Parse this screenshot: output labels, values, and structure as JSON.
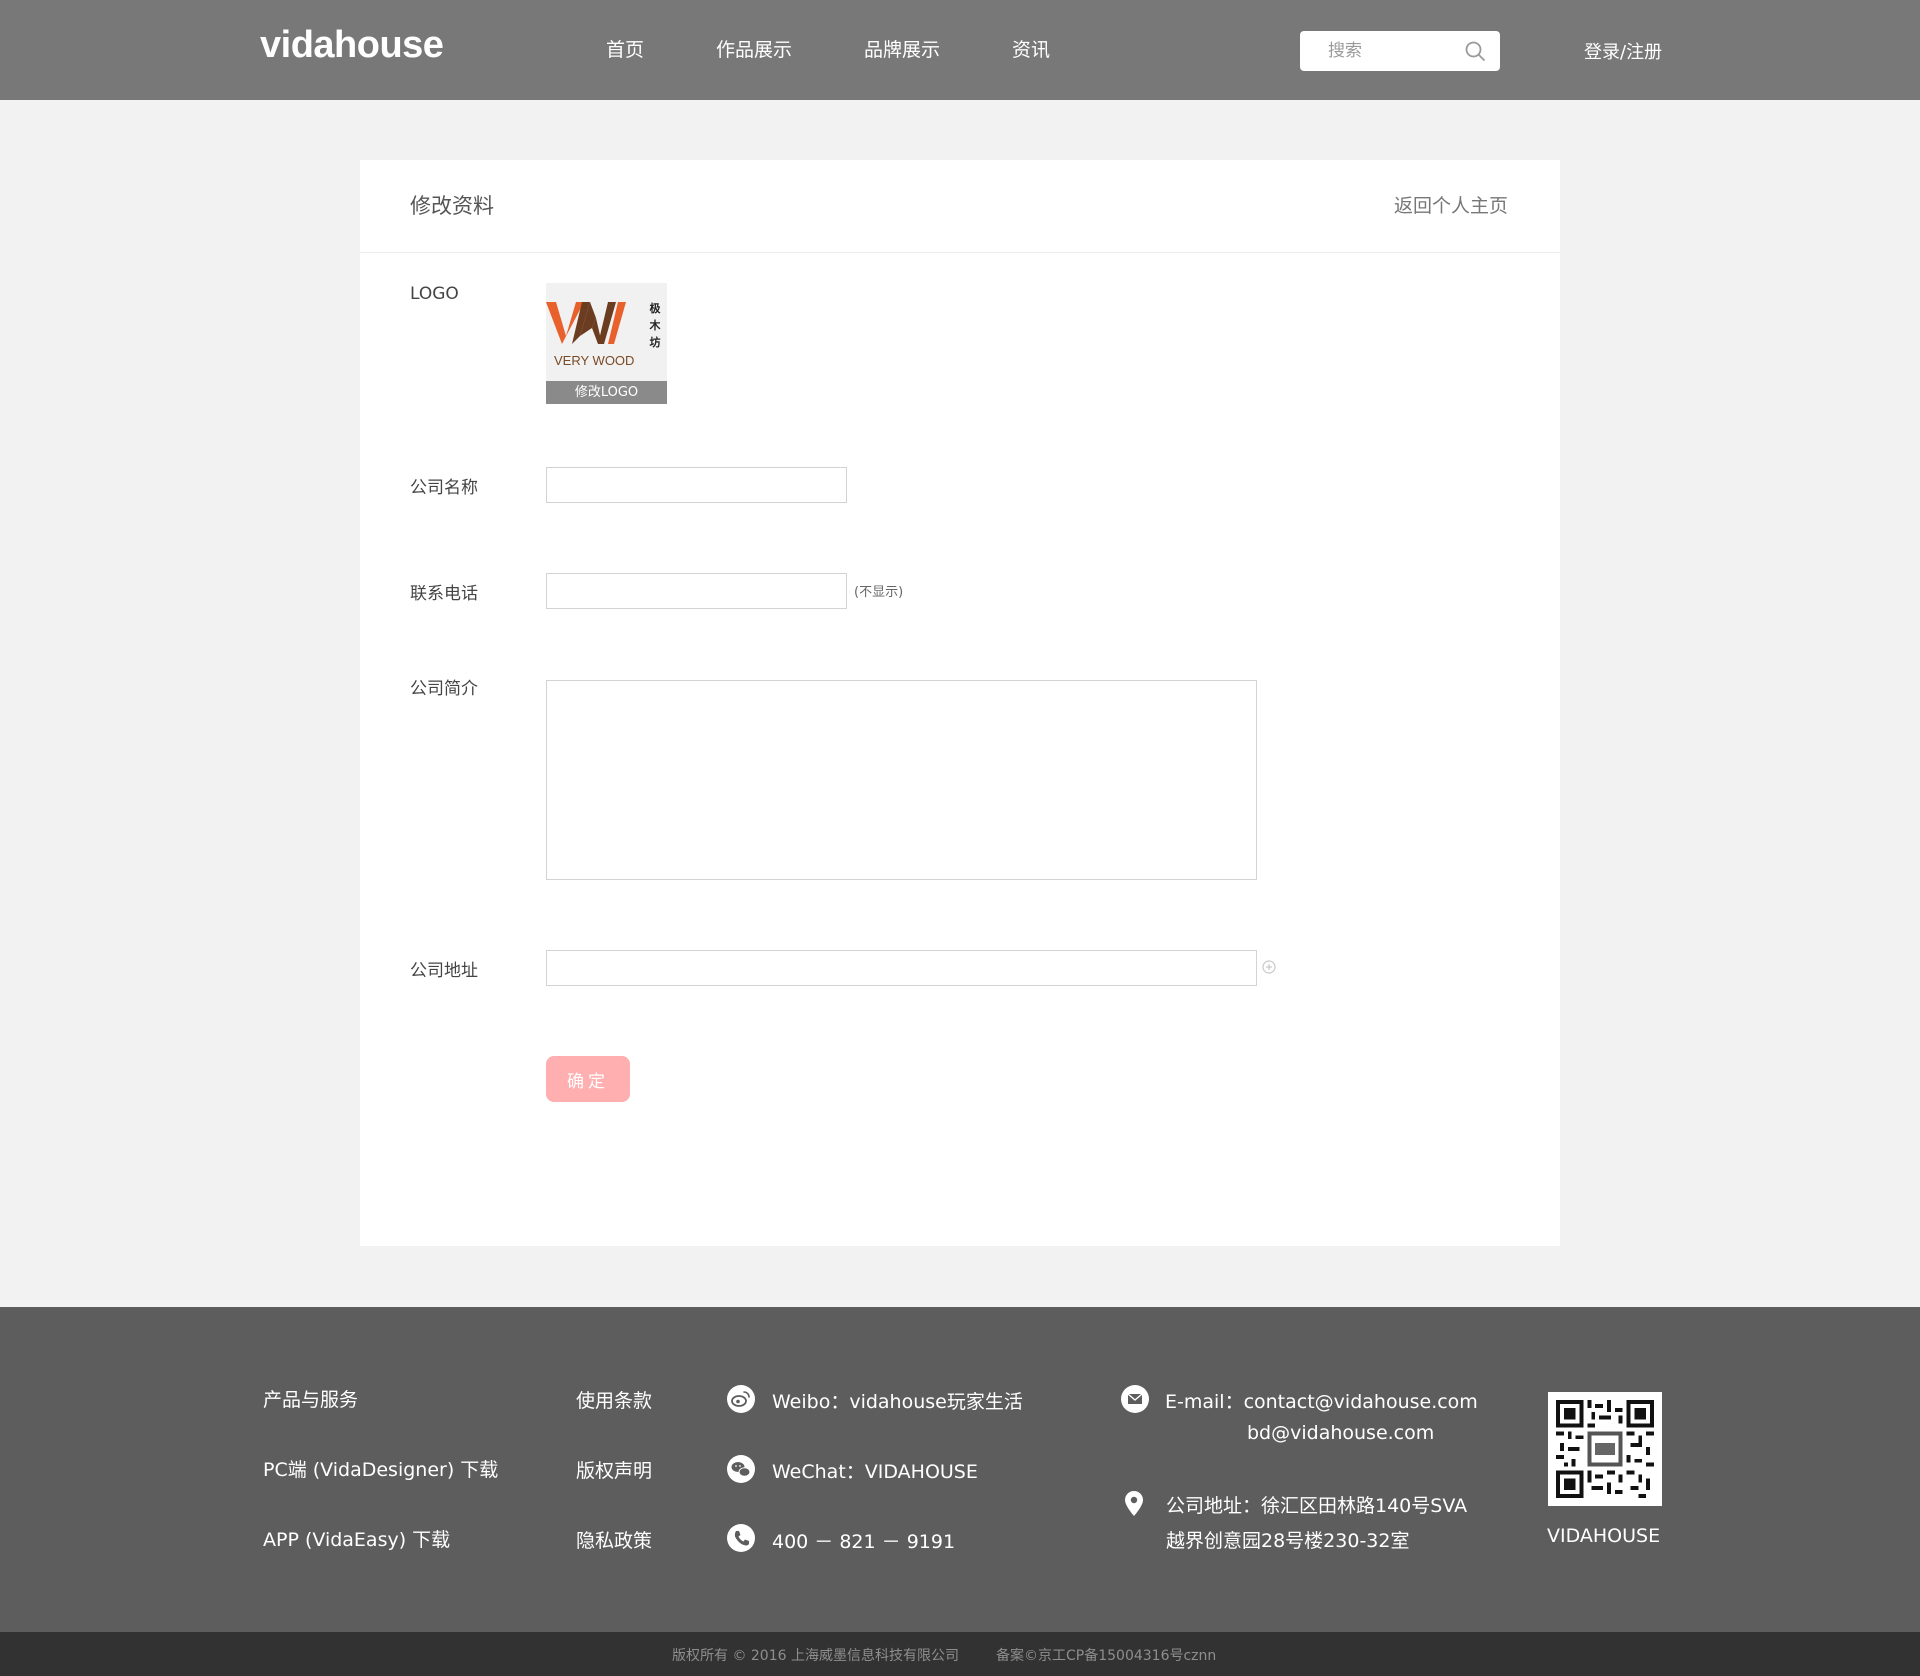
{
  "header": {
    "brand": "vidahouse",
    "nav": [
      {
        "label": "首页"
      },
      {
        "label": "作品展示"
      },
      {
        "label": "品牌展示"
      },
      {
        "label": "资讯"
      }
    ],
    "search": {
      "placeholder": "搜索"
    },
    "login_label": "登录/注册"
  },
  "card": {
    "title": "修改资料",
    "back_link": "返回个人主页",
    "logo": {
      "label": "LOGO",
      "brand_text": "VERY WOOD",
      "brand_cn": "极木坊",
      "change_label": "修改LOGO",
      "colors": {
        "orange": "#e8602c",
        "brown": "#6b3c1f"
      }
    },
    "company_name": {
      "label": "公司名称",
      "value": ""
    },
    "phone": {
      "label": "联系电话",
      "value": "",
      "hint": "(不显示)"
    },
    "intro": {
      "label": "公司简介",
      "value": ""
    },
    "address": {
      "label": "公司地址",
      "value": ""
    },
    "confirm_label": "确定",
    "confirm_color": "#ffafaf"
  },
  "footer": {
    "col1": [
      "产品与服务",
      "PC端 (VidaDesigner) 下载",
      "APP (VidaEasy) 下载"
    ],
    "col2": [
      "使用条款",
      "版权声明",
      "隐私政策"
    ],
    "weibo": "Weibo：vidahouse玩家生活",
    "wechat": "WeChat：VIDAHOUSE",
    "phone": "400 － 821 － 9191",
    "email_line1": "E-mail：contact@vidahouse.com",
    "email_line2": "bd@vidahouse.com",
    "address_line1": "公司地址：徐汇区田林路140号SVA",
    "address_line2": "越界创意园28号楼230-32室",
    "qr_caption": "VIDAHOUSE"
  },
  "copyright": {
    "left": "版权所有 © 2016 上海威墨信息科技有限公司",
    "right": "备案©京工CP备15004316号cznn"
  }
}
